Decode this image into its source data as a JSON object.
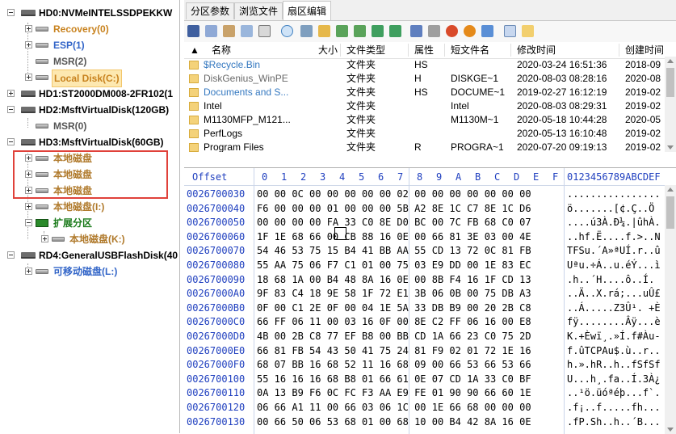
{
  "tree": {
    "hd0": "HD0:NVMeINTELSSDPEKKW",
    "hd0_children": [
      "Recovery(0)",
      "ESP(1)",
      "MSR(2)",
      "Local Disk(C:)"
    ],
    "hd1": "HD1:ST2000DM008-2FR102(1",
    "hd2": "HD2:MsftVirtualDisk(120GB)",
    "hd2_children": [
      "MSR(0)"
    ],
    "hd3": "HD3:MsftVirtualDisk(60GB)",
    "hd3_children": [
      "本地磁盘",
      "本地磁盘",
      "本地磁盘",
      "本地磁盘(I:)"
    ],
    "ext": "扩展分区",
    "ext_child": "本地磁盘(K:)",
    "rd4": "RD4:GeneralUSBFlashDisk(40",
    "rd4_child": "可移动磁盘(L:)"
  },
  "tabs": [
    "分区参数",
    "浏览文件",
    "扇区编辑"
  ],
  "active_tab": "扇区编辑",
  "file_columns": [
    "名称",
    "大小",
    "文件类型",
    "属性",
    "短文件名",
    "修改时间",
    "创建时间"
  ],
  "files": [
    {
      "name": "$Recycle.Bin",
      "size": "",
      "type": "文件夹",
      "attr": "HS",
      "short": "",
      "mtime": "2020-03-24 16:51:36",
      "ctime": "2018-09",
      "color": "#3478c0"
    },
    {
      "name": "DiskGenius_WinPE",
      "size": "",
      "type": "文件夹",
      "attr": "H",
      "short": "DISKGE~1",
      "mtime": "2020-08-03 08:28:16",
      "ctime": "2020-08",
      "color": "#6a6a6a"
    },
    {
      "name": "Documents and S...",
      "size": "",
      "type": "文件夹",
      "attr": "HS",
      "short": "DOCUME~1",
      "mtime": "2019-02-27 16:12:19",
      "ctime": "2019-02",
      "color": "#3478c0"
    },
    {
      "name": "Intel",
      "size": "",
      "type": "文件夹",
      "attr": "",
      "short": "Intel",
      "mtime": "2020-08-03 08:29:31",
      "ctime": "2019-02",
      "color": "#000000"
    },
    {
      "name": "M1130MFP_M121...",
      "size": "",
      "type": "文件夹",
      "attr": "",
      "short": "M1130M~1",
      "mtime": "2020-05-18 10:44:28",
      "ctime": "2020-05",
      "color": "#000000"
    },
    {
      "name": "PerfLogs",
      "size": "",
      "type": "文件夹",
      "attr": "",
      "short": "",
      "mtime": "2020-05-13 16:10:48",
      "ctime": "2019-02",
      "color": "#000000"
    },
    {
      "name": "Program Files",
      "size": "",
      "type": "文件夹",
      "attr": "R",
      "short": "PROGRA~1",
      "mtime": "2020-07-20 09:19:13",
      "ctime": "2019-02",
      "color": "#000000"
    }
  ],
  "hex_header": {
    "offset": "Offset",
    "cols": [
      "0",
      "1",
      "2",
      "3",
      "4",
      "5",
      "6",
      "7",
      "8",
      "9",
      "A",
      "B",
      "C",
      "D",
      "E",
      "F"
    ],
    "ascii": "0123456789ABCDEF"
  },
  "hex_rows": [
    {
      "off": "0026700030",
      "bytes": "00 00 0C 00 00 00 00 00 02 00 00 00 00 00 00 00",
      "ascii": "................"
    },
    {
      "off": "0026700040",
      "bytes": "F6 00 00 00 01 00 00 00 5B A2 8E 1C C7 8E 1C D6",
      "ascii": "ö.......[¢.Ç..Ö"
    },
    {
      "off": "0026700050",
      "bytes": "00 00 00 00 FA 33 C0 8E D0 BC 00 7C FB 68 C0 07",
      "ascii": "....ú3À.Ð¼.|ûhÀ."
    },
    {
      "off": "0026700060",
      "bytes": "1F 1E 68 66 00 CB 88 16 0E 00 66 81 3E 03 00 4E",
      "ascii": "..hf.Ë....f.>..N"
    },
    {
      "off": "0026700070",
      "bytes": "54 46 53 75 15 B4 41 BB AA 55 CD 13 72 0C 81 FB",
      "ascii": "TFSu.´A»ªUÍ.r..û"
    },
    {
      "off": "0026700080",
      "bytes": "55 AA 75 06 F7 C1 01 00 75 03 E9 DD 00 1E 83 EC",
      "ascii": "Uªu.÷Á..u.éÝ...ì"
    },
    {
      "off": "0026700090",
      "bytes": "18 68 1A 00 B4 48 8A 16 0E 00 8B F4 16 1F CD 13",
      "ascii": ".h..´H....ô..Í."
    },
    {
      "off": "00267000A0",
      "bytes": "9F 83 C4 18 9E 58 1F 72 E1 3B 06 0B 00 75 DB A3",
      "ascii": "..Ä..X.rá;...uÛ£"
    },
    {
      "off": "00267000B0",
      "bytes": "0F 00 C1 2E 0F 00 04 1E 5A 33 DB B9 00 20 2B C8",
      "ascii": "..Á.....Z3Û¹. +È"
    },
    {
      "off": "00267000C0",
      "bytes": "66 FF 06 11 00 03 16 0F 00 8E C2 FF 06 16 00 E8",
      "ascii": "fÿ........Âÿ...è"
    },
    {
      "off": "00267000D0",
      "bytes": "4B 00 2B C8 77 EF B8 00 BB CD 1A 66 23 C0 75 2D",
      "ascii": "K.+Èwï¸.»Í.f#Àu-"
    },
    {
      "off": "00267000E0",
      "bytes": "66 81 FB 54 43 50 41 75 24 81 F9 02 01 72 1E 16",
      "ascii": "f.ûTCPAu$.ù..r.."
    },
    {
      "off": "00267000F0",
      "bytes": "68 07 BB 16 68 52 11 16 68 09 00 66 53 66 53 66",
      "ascii": "h.».hR..h..fSfSf"
    },
    {
      "off": "0026700100",
      "bytes": "55 16 16 16 68 B8 01 66 61 0E 07 CD 1A 33 C0 BF",
      "ascii": "U...h¸.fa..Í.3À¿"
    },
    {
      "off": "0026700110",
      "bytes": "0A 13 B9 F6 0C FC F3 AA E9 FE 01 90 90 66 60 1E",
      "ascii": "..¹ö.üóªéþ...f`."
    },
    {
      "off": "0026700120",
      "bytes": "06 66 A1 11 00 66 03 06 1C 00 1E 66 68 00 00 00",
      "ascii": ".f¡..f.....fh..."
    },
    {
      "off": "0026700130",
      "bytes": "00 66 50 06 53 68 01 00 68 10 00 B4 42 8A 16 0E",
      "ascii": ".fP.Sh..h..´B..."
    }
  ]
}
